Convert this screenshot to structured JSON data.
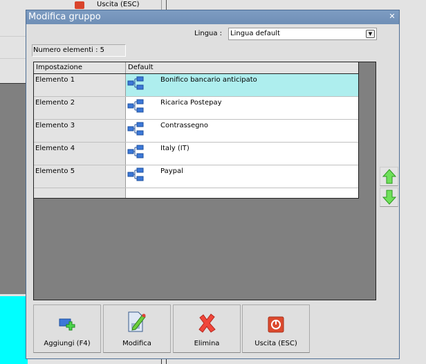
{
  "background": {
    "button_label": "Uscita (ESC)"
  },
  "dialog": {
    "title": "Modifica gruppo",
    "lingua_label": "Lingua :",
    "lingua_value": "Lingua default",
    "count_text": "Numero elementi : 5",
    "table": {
      "headers": [
        "Impostazione",
        "Default"
      ],
      "rows": [
        {
          "name": "Elemento 1",
          "value": "Bonifico bancario anticipato"
        },
        {
          "name": "Elemento 2",
          "value": "Ricarica Postepay"
        },
        {
          "name": "Elemento 3",
          "value": "Contrassegno"
        },
        {
          "name": "Elemento 4",
          "value": "Italy (IT)"
        },
        {
          "name": "Elemento 5",
          "value": "Paypal"
        }
      ]
    },
    "buttons": {
      "add": "Aggiungi (F4)",
      "edit": "Modifica",
      "delete": "Elimina",
      "exit": "Uscita (ESC)"
    }
  }
}
